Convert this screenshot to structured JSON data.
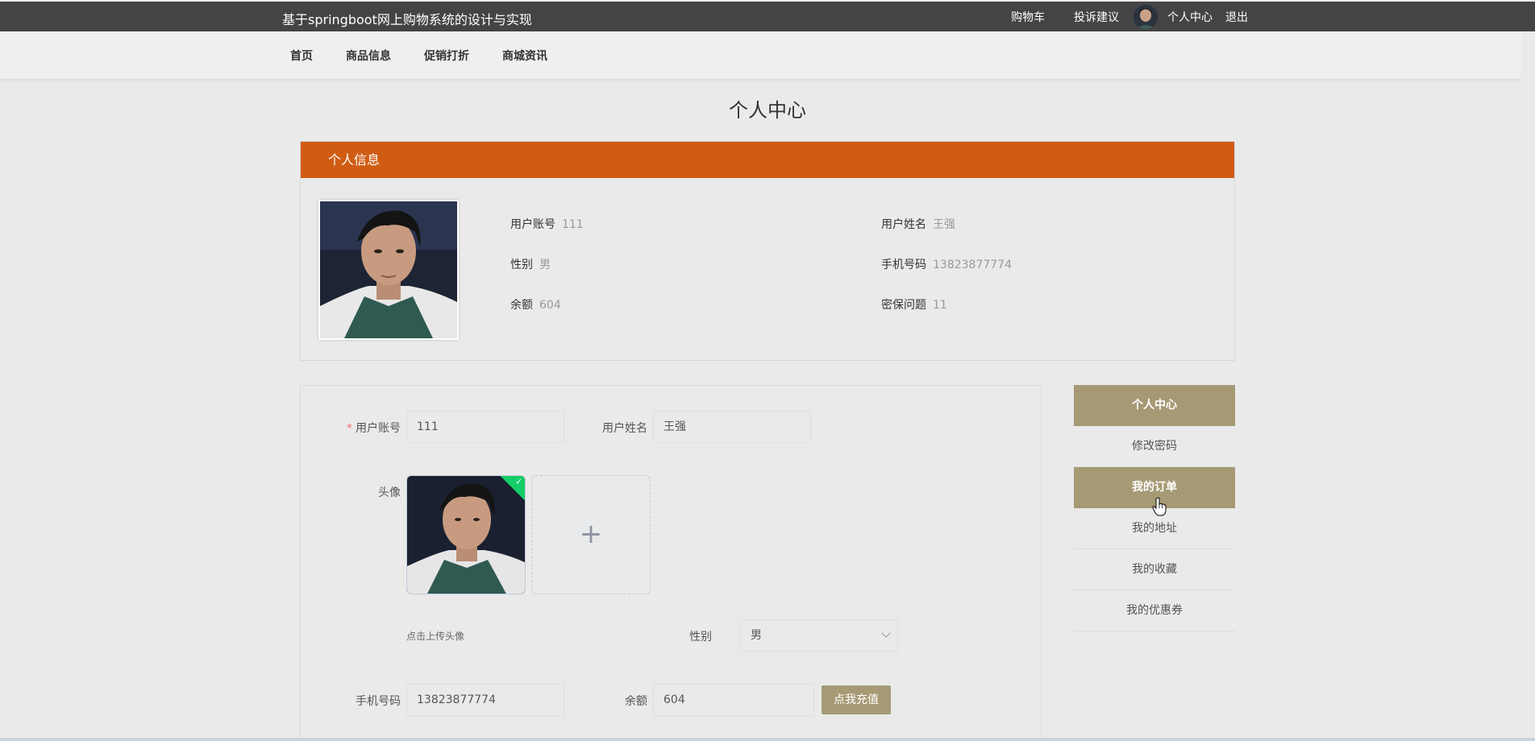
{
  "header": {
    "site_title": "基于springboot网上购物系统的设计与实现",
    "links": {
      "cart": "购物车",
      "feedback": "投诉建议",
      "profile": "个人中心",
      "logout": "退出"
    }
  },
  "nav": {
    "items": [
      "首页",
      "商品信息",
      "促销打折",
      "商城资讯"
    ]
  },
  "page_title": "个人中心",
  "info": {
    "heading": "个人信息",
    "fields": {
      "account_label": "用户账号",
      "account": "111",
      "name_label": "用户姓名",
      "name": "王强",
      "gender_label": "性别",
      "gender": "男",
      "phone_label": "手机号码",
      "phone": "13823877774",
      "balance_label": "余额",
      "balance": "604",
      "security_label": "密保问题",
      "security": "11"
    }
  },
  "form": {
    "account_label": "用户账号",
    "account_value": "111",
    "name_label": "用户姓名",
    "name_value": "王强",
    "avatar_label": "头像",
    "upload_tip": "点击上传头像",
    "upload_plus": "+",
    "gender_label": "性别",
    "gender_value": "男",
    "phone_label": "手机号码",
    "phone_value": "13823877774",
    "balance_label": "余额",
    "balance_value": "604",
    "recharge_button": "点我充值"
  },
  "side_menu": {
    "items": [
      {
        "label": "个人中心",
        "active": true
      },
      {
        "label": "修改密码",
        "active": false
      },
      {
        "label": "我的订单",
        "active": true
      },
      {
        "label": "我的地址",
        "active": false
      },
      {
        "label": "我的收藏",
        "active": false
      },
      {
        "label": "我的优惠券",
        "active": false
      }
    ]
  },
  "colors": {
    "accent_orange": "#d05c13",
    "accent_khaki": "#a69a75",
    "topbar": "#444444",
    "success": "#13ce66"
  }
}
